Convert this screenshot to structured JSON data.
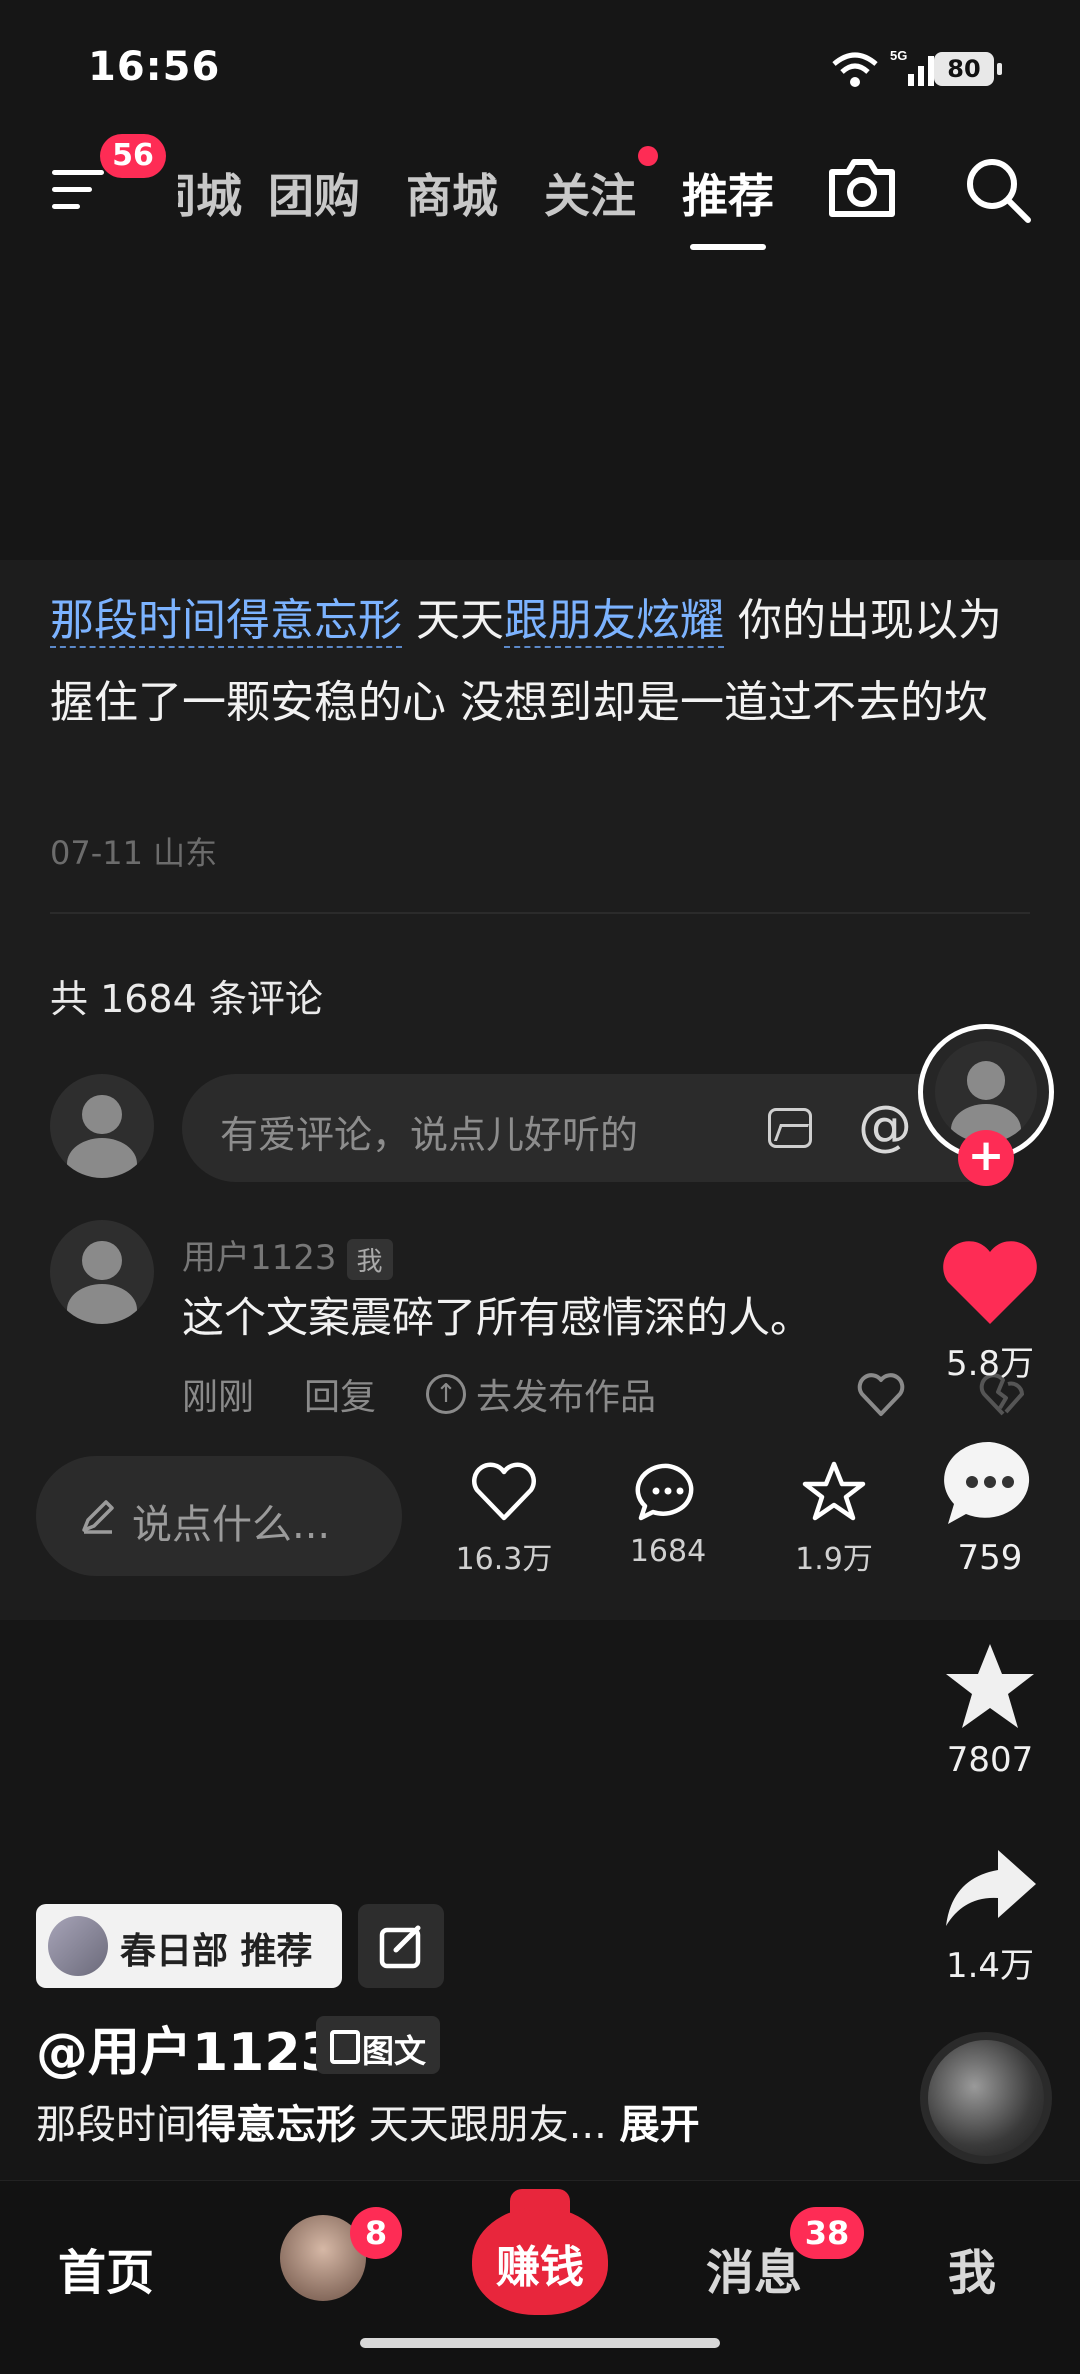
{
  "status_bar": {
    "time": "16:56",
    "battery": "80",
    "network": "5G"
  },
  "top_nav": {
    "menu_badge": "56",
    "tabs": [
      "同城",
      "团购",
      "商城",
      "关注",
      "推荐"
    ],
    "active_tab": "推荐"
  },
  "post": {
    "caption_parts": [
      "那段时间得意忘形",
      " 天天",
      "跟朋友炫耀",
      " 你的出现以为握住了一颗安稳的心 没想到却是一道过不去的坎"
    ],
    "date_location": "07-11 山东",
    "comment_count_text": "共 1684 条评论"
  },
  "comment_input": {
    "placeholder": "有爱评论，说点儿好听的"
  },
  "comment": {
    "username": "用户1123",
    "me_tag": "我",
    "text": "这个文案震碎了所有感情深的人。",
    "time": "刚刚",
    "reply": "回复",
    "publish": "去发布作品"
  },
  "panel_actions": {
    "say_placeholder": "说点什么...",
    "like_count": "16.3万",
    "comment_count": "1684",
    "fav_count": "1.9万"
  },
  "right_rail": {
    "like_count": "5.8万",
    "comment_count": "759",
    "star_count": "7807",
    "share_count": "1.4万"
  },
  "author_area": {
    "chip_label": "春日部 推荐",
    "author": "@用户1123",
    "kind": "图文",
    "desc_plain": "那段时间",
    "desc_bold": "得意忘形",
    "desc_rest": " 天天跟朋友... ",
    "expand": "展开"
  },
  "bottom_nav": {
    "home": "首页",
    "friend_badge": "8",
    "earn": "赚钱",
    "messages": "消息",
    "messages_badge": "38",
    "me": "我"
  },
  "colors": {
    "accent": "#fe2c55",
    "link": "#7cb3ff",
    "background": "#161616"
  }
}
